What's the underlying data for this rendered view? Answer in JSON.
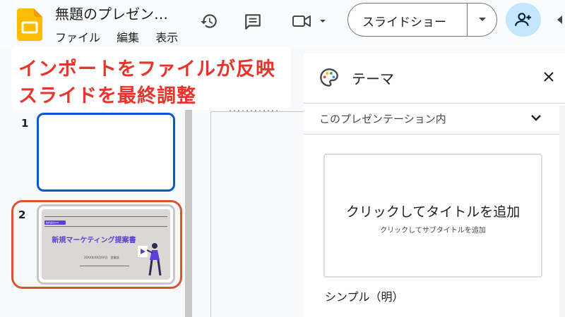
{
  "app": {
    "doc_title": "無題のプレゼン…",
    "menu": [
      "ファイル",
      "編集",
      "表示"
    ]
  },
  "toolbar": {
    "history_icon": "history-icon",
    "comment_icon": "comment-icon",
    "meet_icon": "video-camera-icon",
    "slideshow_label": "スライドショー",
    "share_icon": "add-person-icon"
  },
  "annotation": {
    "line1": "インポートをファイルが反映",
    "line2": "スライドを最終調整",
    "color": "#e8342a"
  },
  "filmstrip": {
    "slides": [
      {
        "number": "1"
      },
      {
        "number": "2",
        "badge": "株式会社XXX",
        "title": "新規マーケティング提案書",
        "meta": "20XX年XX月XX日　営業部"
      }
    ]
  },
  "theme_panel": {
    "title": "テーマ",
    "section": "このプレゼンテーション内",
    "card_title": "クリックしてタイトルを追加",
    "card_subtitle": "クリックしてサブタイトルを追加",
    "theme_name": "シンプル（明）"
  },
  "colors": {
    "accent": "#0b57d0",
    "highlight": "#d9542f",
    "share_bg": "#c2e7ff"
  }
}
